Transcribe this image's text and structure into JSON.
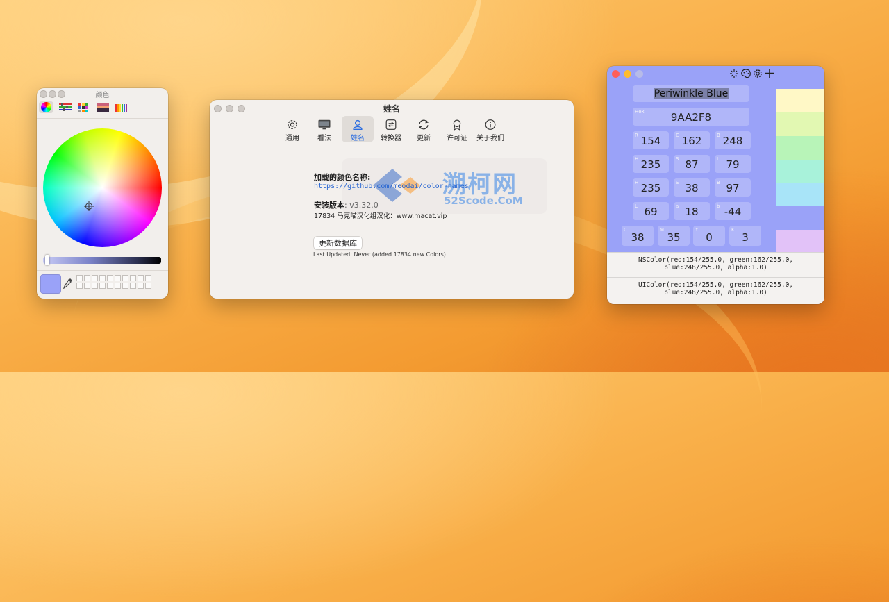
{
  "color_panel": {
    "title": "颜色",
    "tabs": [
      "color-wheel",
      "sliders",
      "palettes",
      "image",
      "pencils"
    ]
  },
  "prefs": {
    "title": "姓名",
    "tabs": [
      {
        "label": "通用",
        "icon": "gear-icon"
      },
      {
        "label": "看法",
        "icon": "display-icon"
      },
      {
        "label": "姓名",
        "icon": "person-icon"
      },
      {
        "label": "转换器",
        "icon": "converter-icon"
      },
      {
        "label": "更新",
        "icon": "refresh-icon"
      },
      {
        "label": "许可证",
        "icon": "badge-icon"
      },
      {
        "label": "关于我们",
        "icon": "info-icon"
      }
    ],
    "loaded_label": "加载的颜色名称:",
    "loaded_url": "https://github.com/meodai/color-names",
    "version_label": "安装版本",
    "version_value": ": v3.32.0",
    "credit": "17834 马克喵汉化组汉化：www.macat.vip",
    "update_button": "更新数据库",
    "last_updated": "Last Updated: Never (added 17834 new Colors)",
    "watermark_main": "溯柯网",
    "watermark_sub": "52Scode.CoM"
  },
  "names": {
    "color_name": "Periwinkle Blue",
    "hex_caption": "Hex",
    "hex": "9AA2F8",
    "rgb": [
      {
        "cap": "R",
        "val": "154"
      },
      {
        "cap": "G",
        "val": "162"
      },
      {
        "cap": "B",
        "val": "248"
      }
    ],
    "hsl": [
      {
        "cap": "H",
        "val": "235"
      },
      {
        "cap": "S",
        "val": "87"
      },
      {
        "cap": "L",
        "val": "79"
      }
    ],
    "hsb": [
      {
        "cap": "H",
        "val": "235"
      },
      {
        "cap": "S",
        "val": "38"
      },
      {
        "cap": "B",
        "val": "97"
      }
    ],
    "lab": [
      {
        "cap": "L",
        "val": "69"
      },
      {
        "cap": "a",
        "val": "18"
      },
      {
        "cap": "b",
        "val": "-44"
      }
    ],
    "cmyk": [
      {
        "cap": "C",
        "val": "38"
      },
      {
        "cap": "M",
        "val": "35"
      },
      {
        "cap": "Y",
        "val": "0"
      },
      {
        "cap": "K",
        "val": "3"
      }
    ],
    "nscolor": "NSColor(red:154/255.0, green:162/255.0,\nblue:248/255.0, alpha:1.0)",
    "uicolor": "UIColor(red:154/255.0, green:162/255.0,\nblue:248/255.0, alpha:1.0)",
    "accent": "#9AA2F8",
    "strip_colors": [
      "#FFF8C6",
      "#E2F8B2",
      "#B8F4B8",
      "#A8F2DA",
      "#A8E4F8",
      "#9AA2F8",
      "#E2C2F8"
    ]
  }
}
